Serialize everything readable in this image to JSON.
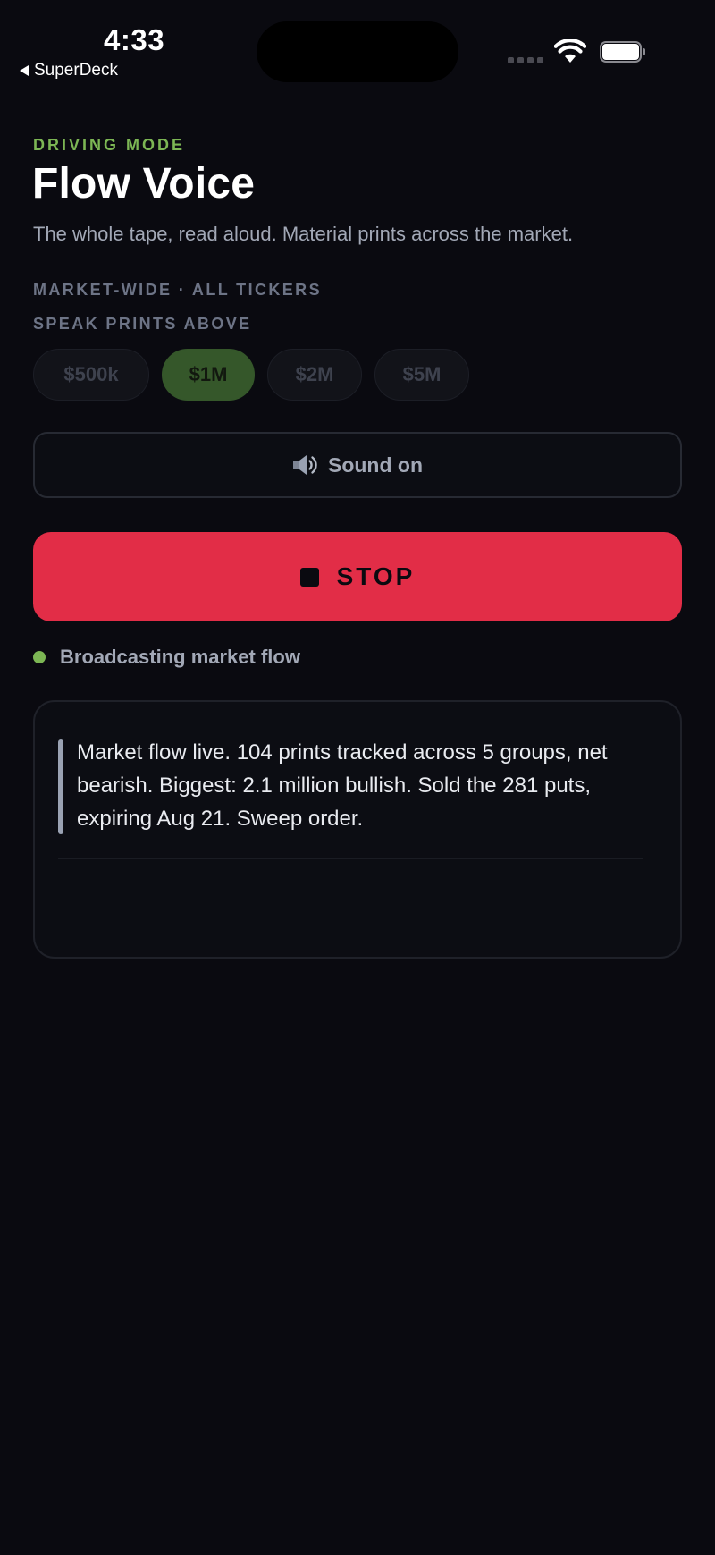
{
  "status_bar": {
    "time": "4:33",
    "back_app": "SuperDeck",
    "icons": [
      "signal-dots-icon",
      "wifi-icon",
      "battery-icon"
    ]
  },
  "header": {
    "eyebrow": "DRIVING MODE",
    "title": "Flow Voice",
    "subtitle": "The whole tape, read aloud. Material prints across the market."
  },
  "scope": {
    "label": "MARKET-WIDE · ALL TICKERS"
  },
  "threshold": {
    "label": "SPEAK PRINTS ABOVE",
    "options": [
      "$500k",
      "$1M",
      "$2M",
      "$5M"
    ],
    "selected": "$1M"
  },
  "sound_toggle": {
    "icon": "speaker-icon",
    "label": "Sound on"
  },
  "stop_button": {
    "icon": "stop-icon",
    "label": "STOP"
  },
  "status": {
    "text": "Broadcasting market flow"
  },
  "feed": {
    "items": [
      {
        "text": "Market flow live. 104 prints tracked across 5 groups, net bearish. Biggest: 2.1 million bullish. Sold the 281 puts, expiring Aug 21. Sweep order."
      }
    ]
  },
  "colors": {
    "background": "#0a0a10",
    "accent_green": "#7cb654",
    "stop_red": "#e22d47",
    "muted_text": "#a2a8b6"
  }
}
